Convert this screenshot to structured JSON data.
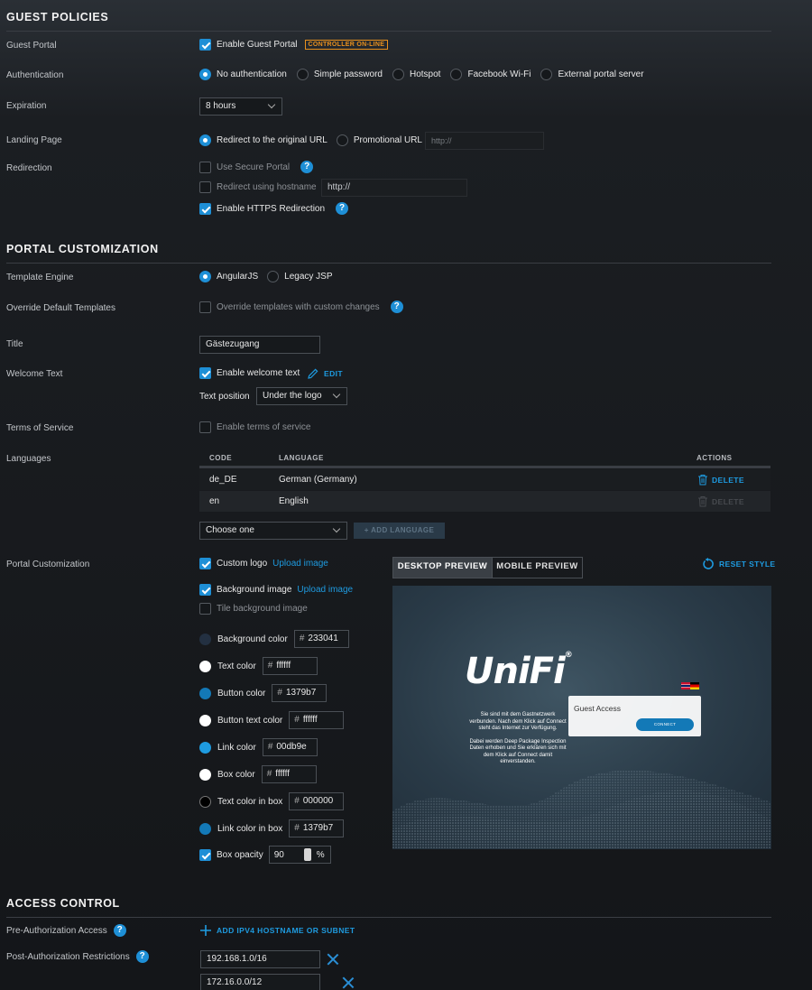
{
  "guest_policies": {
    "title": "GUEST POLICIES",
    "guest_portal": {
      "label": "Guest Portal",
      "checkbox": "Enable Guest Portal",
      "badge": "CONTROLLER ON-LINE"
    },
    "authentication": {
      "label": "Authentication",
      "options": [
        "No authentication",
        "Simple password",
        "Hotspot",
        "Facebook Wi-Fi",
        "External portal server"
      ]
    },
    "expiration": {
      "label": "Expiration",
      "value": "8 hours"
    },
    "landing_page": {
      "label": "Landing Page",
      "options": [
        "Redirect to the original URL",
        "Promotional URL"
      ],
      "placeholder": "http://"
    },
    "redirection": {
      "label": "Redirection",
      "secure_portal": "Use Secure Portal",
      "hostname": "Redirect using hostname",
      "hostname_placeholder": "http://",
      "https": "Enable HTTPS Redirection"
    }
  },
  "portal_customization": {
    "title": "PORTAL CUSTOMIZATION",
    "template_engine": {
      "label": "Template Engine",
      "options": [
        "AngularJS",
        "Legacy JSP"
      ]
    },
    "override": {
      "label": "Override Default Templates",
      "checkbox": "Override templates with custom changes"
    },
    "title_field": {
      "label": "Title",
      "value": "Gästezugang"
    },
    "welcome": {
      "label": "Welcome Text",
      "checkbox": "Enable welcome text",
      "edit": "EDIT",
      "position_label": "Text position",
      "position_value": "Under the logo"
    },
    "tos": {
      "label": "Terms of Service",
      "checkbox": "Enable terms of service"
    },
    "languages": {
      "label": "Languages",
      "headers": [
        "CODE",
        "LANGUAGE",
        "ACTIONS"
      ],
      "rows": [
        {
          "code": "de_DE",
          "language": "German (Germany)",
          "action": "DELETE"
        },
        {
          "code": "en",
          "language": "English",
          "action": "DELETE"
        }
      ],
      "choose": "Choose one",
      "add": "ADD LANGUAGE"
    },
    "custom": {
      "label": "Portal Customization",
      "logo": "Custom logo",
      "logo_link": "Upload image",
      "bg_image": "Background image",
      "bg_link": "Upload image",
      "tile": "Tile background image",
      "colors": [
        {
          "label": "Background color",
          "hex": "233041",
          "swatch": "#233041"
        },
        {
          "label": "Text color",
          "hex": "ffffff",
          "swatch": "#ffffff"
        },
        {
          "label": "Button color",
          "hex": "1379b7",
          "swatch": "#1379b7"
        },
        {
          "label": "Button text color",
          "hex": "ffffff",
          "swatch": "#ffffff"
        },
        {
          "label": "Link color",
          "hex": "00db9e",
          "swatch": "#1e9be0"
        },
        {
          "label": "Box color",
          "hex": "ffffff",
          "swatch": "#ffffff"
        },
        {
          "label": "Text color in box",
          "hex": "000000",
          "swatch": "#000000"
        },
        {
          "label": "Link color in box",
          "hex": "1379b7",
          "swatch": "#1379b7"
        }
      ],
      "opacity_label": "Box opacity",
      "opacity_value": "90",
      "opacity_unit": "%"
    },
    "preview": {
      "tabs": [
        "DESKTOP PREVIEW",
        "MOBILE PREVIEW"
      ],
      "reset": "RESET STYLE",
      "logo_text": "UniFi",
      "welcome_p1": "Sie sind mit dem Gastnetzwerk verbunden. Nach dem Klick auf Connect steht das Internet zur Verfügung.",
      "welcome_p2": "Dabei werden Deep Package Inspection Daten erhoben und Sie erklären sich mit dem Klick auf Connect damit einverstanden.",
      "box_title": "Guest Access",
      "box_button": "CONNECT"
    }
  },
  "access_control": {
    "title": "ACCESS CONTROL",
    "pre_auth": {
      "label": "Pre-Authorization Access",
      "add": "ADD IPV4 HOSTNAME OR SUBNET"
    },
    "post_auth": {
      "label": "Post-Authorization Restrictions",
      "entries": [
        "192.168.1.0/16",
        "172.16.0.0/12"
      ]
    }
  }
}
